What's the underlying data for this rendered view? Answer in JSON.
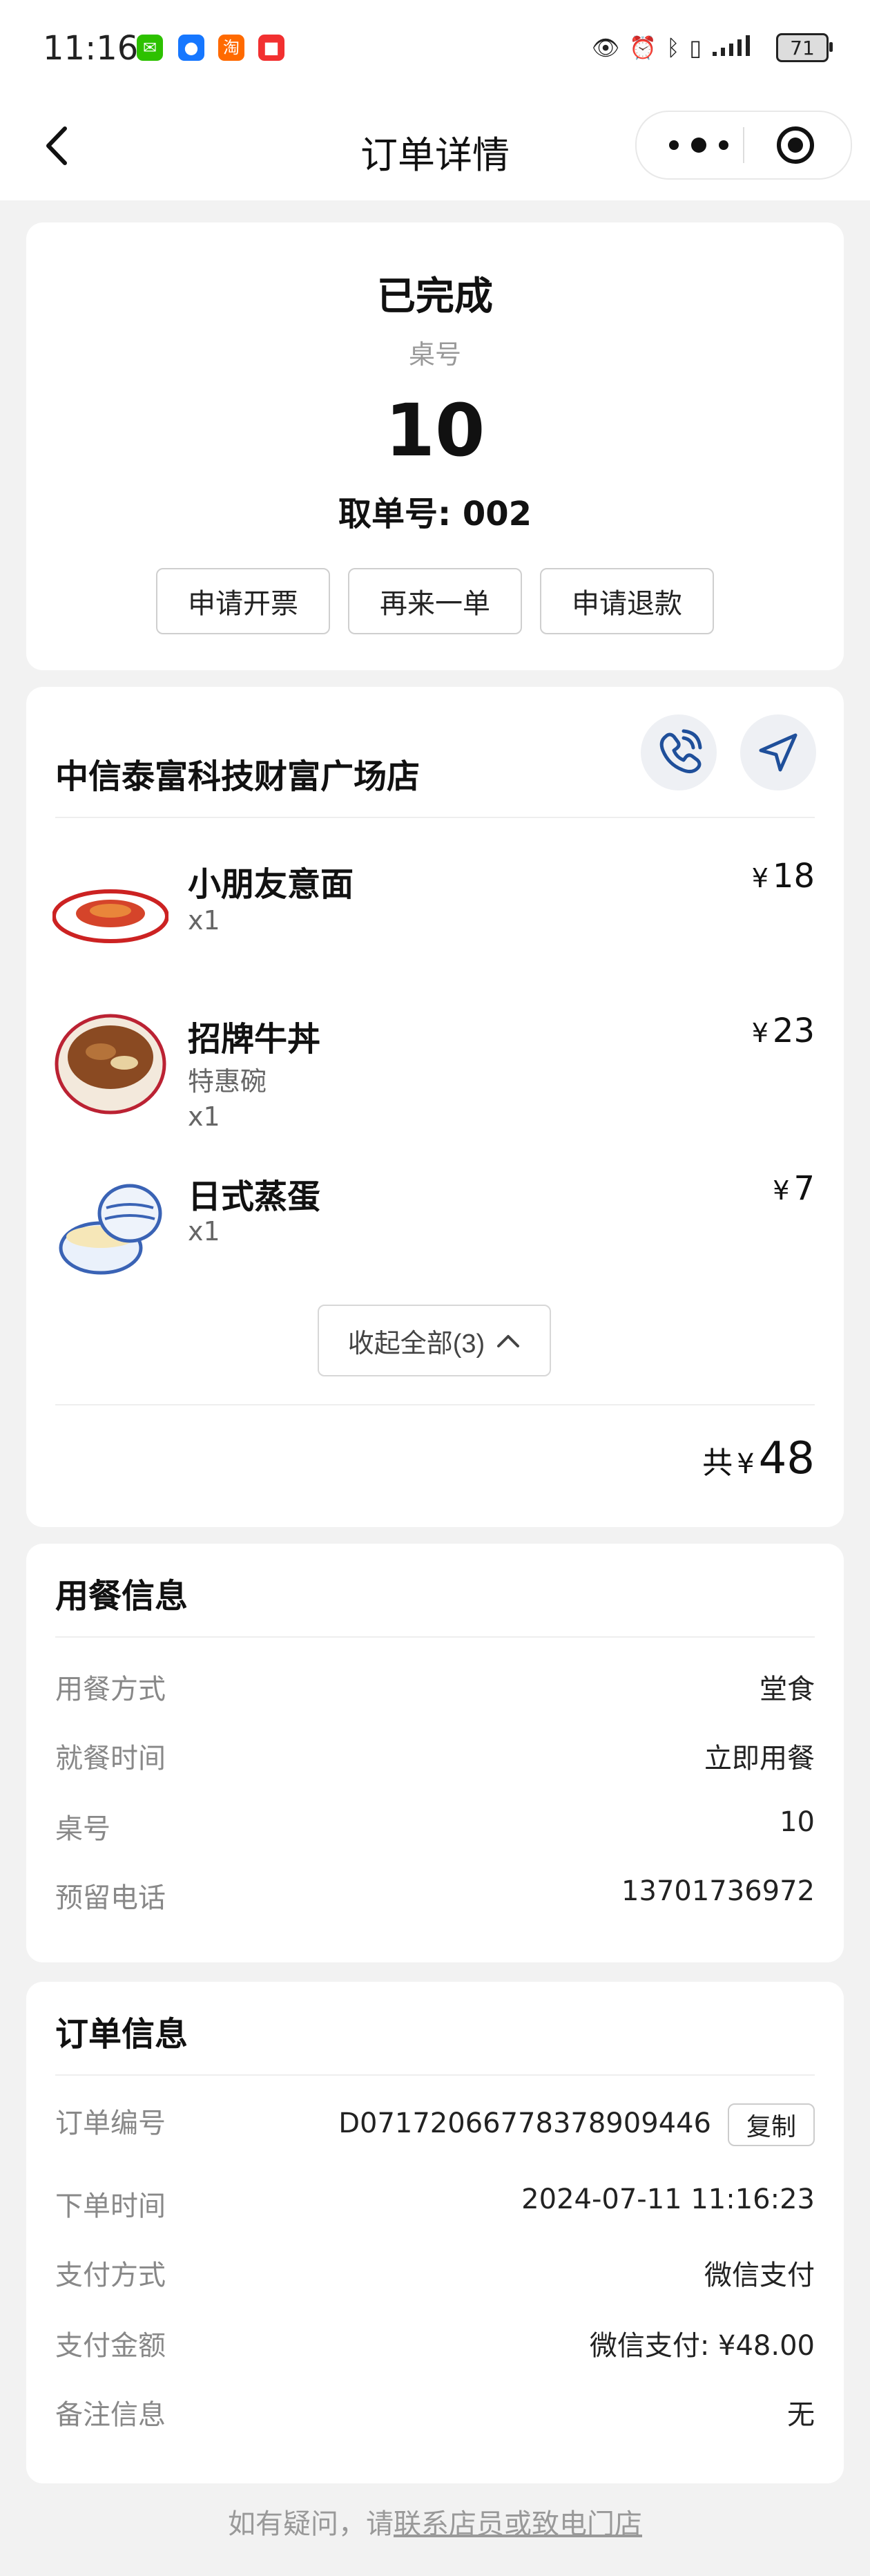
{
  "status_bar": {
    "time": "11:16",
    "apps": [
      {
        "icon": "wechat-icon",
        "color": "#2dc100",
        "glyph": "✉"
      },
      {
        "icon": "app-blue-icon",
        "color": "#1677ff",
        "glyph": "●"
      },
      {
        "icon": "taobao-icon",
        "color": "#ff6a00",
        "glyph": "淘"
      },
      {
        "icon": "app-red-icon",
        "color": "#f23030",
        "glyph": "■"
      }
    ],
    "battery": "71"
  },
  "nav": {
    "title": "订单详情"
  },
  "order": {
    "status": "已完成",
    "table_label": "桌号",
    "table_number": "10",
    "pickup": "取单号: 002",
    "actions": [
      "申请开票",
      "再来一单",
      "申请退款"
    ]
  },
  "store": {
    "name": "中信泰富科技财富广场店",
    "items": [
      {
        "name": "小朋友意面",
        "spec": "",
        "qty": "x1",
        "currency": "¥",
        "price": "18"
      },
      {
        "name": "招牌牛丼",
        "spec": "特惠碗",
        "qty": "x1",
        "currency": "¥",
        "price": "23"
      },
      {
        "name": "日式蒸蛋",
        "spec": "",
        "qty": "x1",
        "currency": "¥",
        "price": "7"
      }
    ],
    "collapse_label": "收起全部(3)",
    "total_prefix": "共",
    "total_currency": "¥",
    "total_amount": "48"
  },
  "dining": {
    "title": "用餐信息",
    "rows": [
      {
        "label": "用餐方式",
        "value": "堂食"
      },
      {
        "label": "就餐时间",
        "value": "立即用餐"
      },
      {
        "label": "桌号",
        "value": "10"
      },
      {
        "label": "预留电话",
        "value": "13701736972"
      }
    ]
  },
  "order_info": {
    "title": "订单信息",
    "order_no_label": "订单编号",
    "order_no": "D07172066778378909446",
    "copy_label": "复制",
    "rows": [
      {
        "label": "下单时间",
        "value": "2024-07-11 11:16:23"
      },
      {
        "label": "支付方式",
        "value": "微信支付"
      },
      {
        "label": "支付金额",
        "value": "微信支付: ¥48.00"
      },
      {
        "label": "备注信息",
        "value": "无"
      }
    ]
  },
  "footer": {
    "prefix": "如有疑问，请",
    "link": "联系店员或致电门店"
  },
  "colors": {
    "accent": "#1f4f9a",
    "background": "#f2f2f2",
    "card": "#ffffff"
  }
}
